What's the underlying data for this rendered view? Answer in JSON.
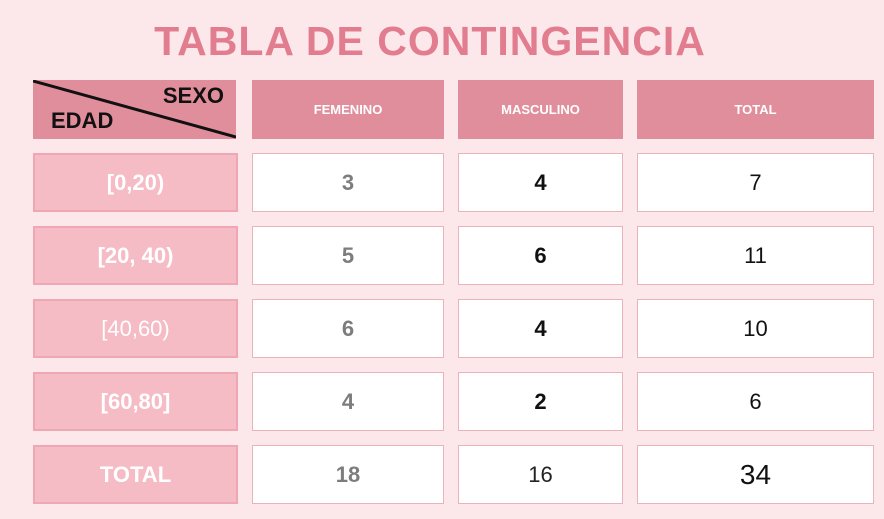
{
  "title": "TABLA DE CONTINGENCIA",
  "corner": {
    "top_label": "SEXO",
    "bottom_label": "EDAD"
  },
  "columns": [
    "FEMENINO",
    "MASCULINO",
    "TOTAL"
  ],
  "rows": [
    {
      "label": "[0,20)",
      "femenino": "3",
      "masculino": "4",
      "total": "7"
    },
    {
      "label": "[20, 40)",
      "femenino": "5",
      "masculino": "6",
      "total": "11"
    },
    {
      "label": "[40,60)",
      "femenino": "6",
      "masculino": "4",
      "total": "10"
    },
    {
      "label": "[60,80]",
      "femenino": "4",
      "masculino": "2",
      "total": "6"
    },
    {
      "label": "TOTAL",
      "femenino": "18",
      "masculino": "16",
      "total": "34"
    }
  ],
  "colors": {
    "background": "#fce8eb",
    "title": "#e27d90",
    "header": "#e08e9c",
    "row_label": "#f5bcc5"
  }
}
